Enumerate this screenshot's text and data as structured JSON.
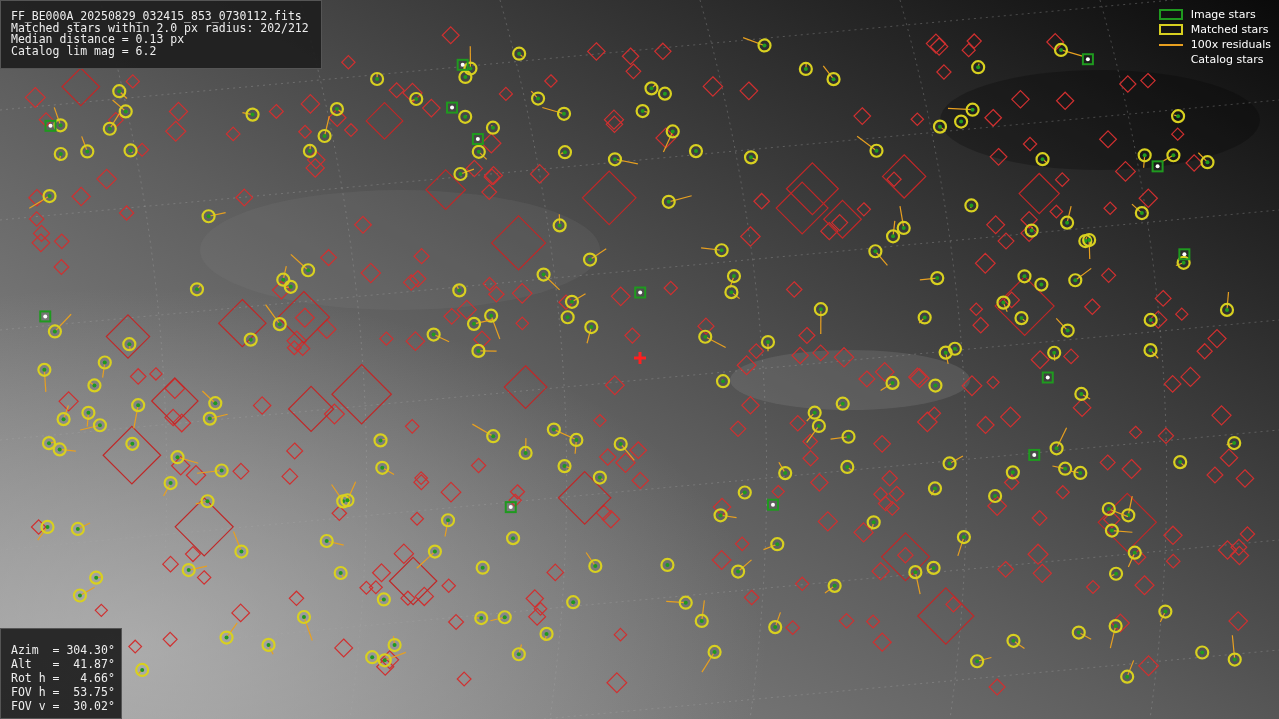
{
  "info_box": {
    "lines": [
      "FF_BE000A_20250829_032415_853_0730112.fits",
      "Matched stars within 2.0 px radius: 202/212",
      "Median distance = 0.13 px",
      "Catalog lim mag = 6.2"
    ]
  },
  "legend": [
    {
      "kind": "box",
      "label": "Image stars",
      "color": "#1f9a1f"
    },
    {
      "kind": "box",
      "label": "Matched stars",
      "color": "#d8d020"
    },
    {
      "kind": "line",
      "label": "100x residuals",
      "color": "#e8a020"
    },
    {
      "kind": "none",
      "label": "Catalog stars"
    }
  ],
  "pointing_box": {
    "lines": [
      "Azim  = 304.30°",
      "Alt   =  41.87°",
      "Rot h =   4.66°",
      "FOV h =  53.75°",
      "FOV v =  30.02°"
    ]
  }
}
